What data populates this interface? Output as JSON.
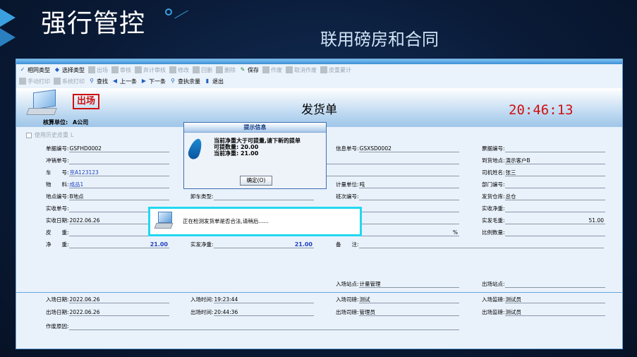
{
  "slide": {
    "title": "强行管控",
    "subtitle": "联用磅房和合同"
  },
  "toolbar": {
    "row1": [
      {
        "label": "相同类型",
        "icon": "check-icon",
        "enabled": true
      },
      {
        "label": "选择类型",
        "icon": "diamond-icon",
        "enabled": true
      },
      {
        "label": "出场",
        "icon": "exit-icon",
        "enabled": false
      },
      {
        "label": "审核",
        "icon": "audit-icon",
        "enabled": false
      },
      {
        "label": "弃计审核",
        "icon": "cancel-audit-icon",
        "enabled": false
      },
      {
        "label": "修改",
        "icon": "wrench-icon",
        "enabled": false
      },
      {
        "label": "回删",
        "icon": "undo-icon",
        "enabled": false
      },
      {
        "label": "删除",
        "icon": "delete-icon",
        "enabled": false
      },
      {
        "label": "保存",
        "icon": "save-icon",
        "enabled": true
      },
      {
        "label": "作废",
        "icon": "void-icon",
        "enabled": false
      },
      {
        "label": "取消作废",
        "icon": "unvoid-icon",
        "enabled": false
      },
      {
        "label": "皮重累计",
        "icon": "tare-sum-icon",
        "enabled": false
      }
    ],
    "row2": [
      {
        "label": "手动打印",
        "icon": "print-icon",
        "enabled": false
      },
      {
        "label": "系统打印",
        "icon": "system-print-icon",
        "enabled": false
      },
      {
        "label": "查找",
        "icon": "search-icon",
        "enabled": true
      },
      {
        "label": "上一条",
        "icon": "prev-icon",
        "enabled": true
      },
      {
        "label": "下一条",
        "icon": "next-icon",
        "enabled": true
      },
      {
        "label": "查执余量",
        "icon": "balance-icon",
        "enabled": true
      },
      {
        "label": "退出",
        "icon": "exit-door-icon",
        "enabled": true
      }
    ]
  },
  "header": {
    "stamp": "出场",
    "unit_label": "核算单位:",
    "unit_value": "A公司",
    "doc_title": "发货单",
    "clock": "20:46:13"
  },
  "history_checkbox": {
    "label": "使用历史皮重",
    "value": "L"
  },
  "fields": {
    "bill_no": {
      "label": "单据编号:",
      "value": "GSFHD0002"
    },
    "offset_no": {
      "label": "冲销单号:",
      "value": ""
    },
    "vehicle_no": {
      "label": "车　　号:",
      "value": "京A123123"
    },
    "material": {
      "label": "物　　料:",
      "value": "成品1"
    },
    "location_no": {
      "label": "地点编号:",
      "value": "B地点"
    },
    "actual_no": {
      "label": "实收单号:",
      "value": ""
    },
    "actual_date": {
      "label": "实收日期:",
      "value": "2022.06.26"
    },
    "tare": {
      "label": "皮　　重:",
      "value": ""
    },
    "net": {
      "label": "净　　重:",
      "value": "21.00"
    },
    "unload_type": {
      "label": "卸车类型:",
      "value": ""
    },
    "actual_net": {
      "label": "实发净重:",
      "value": "21.00"
    },
    "info_no": {
      "label": "信息单号:",
      "value": "GSXSD0002"
    },
    "measure_unit": {
      "label": "计量单位:",
      "value": "吨"
    },
    "shift_no": {
      "label": "班次编号:",
      "value": ""
    },
    "remark": {
      "label": "备　　注:",
      "value": ""
    },
    "percent_mark": "%",
    "ticket_no": {
      "label": "票据编号:",
      "value": ""
    },
    "destination": {
      "label": "到货地点:",
      "value": "演示客户B"
    },
    "driver": {
      "label": "司机姓名:",
      "value": "张三"
    },
    "dept_no": {
      "label": "部门编号:",
      "value": ""
    },
    "warehouse": {
      "label": "发货仓库:",
      "value": "总仓"
    },
    "actual_net2": {
      "label": "实收净重:",
      "value": ""
    },
    "actual_gross": {
      "label": "实发毛重:",
      "value": "51.00"
    },
    "ratio": {
      "label": "比例数量:",
      "value": ""
    },
    "entry_station": {
      "label": "入场站点:",
      "value": "计量管理"
    },
    "exit_station": {
      "label": "出场站点:",
      "value": ""
    },
    "entry_date": {
      "label": "入场日期:",
      "value": "2022.06.26"
    },
    "entry_time": {
      "label": "入场时间:",
      "value": "19:23:44"
    },
    "entry_operator": {
      "label": "入场司磅:",
      "value": "测试"
    },
    "entry_supervisor": {
      "label": "入场监磅:",
      "value": "测试员"
    },
    "exit_date": {
      "label": "出场日期:",
      "value": "2022.06.26"
    },
    "exit_time": {
      "label": "出场时间:",
      "value": "20:44:36"
    },
    "exit_operator": {
      "label": "出场司磅:",
      "value": "管理员"
    },
    "exit_supervisor": {
      "label": "出场监磅:",
      "value": "测试员"
    },
    "void_reason": {
      "label": "作废原因:",
      "value": ""
    }
  },
  "msg_dialog": {
    "title": "提示信息",
    "line1": "当前净重大于可提量,请下新的提单",
    "line2": "可提数量: 20.00",
    "line3": "当前净重: 21.00",
    "ok_label": "确定(O)"
  },
  "check_dialog": {
    "text": "正在检测发货单是否合法,请稍后......"
  },
  "colors": {
    "clock": "#d01010",
    "stamp": "#d01010",
    "highlight_border": "#22d8f0",
    "value_blue": "#1f3fbf"
  }
}
